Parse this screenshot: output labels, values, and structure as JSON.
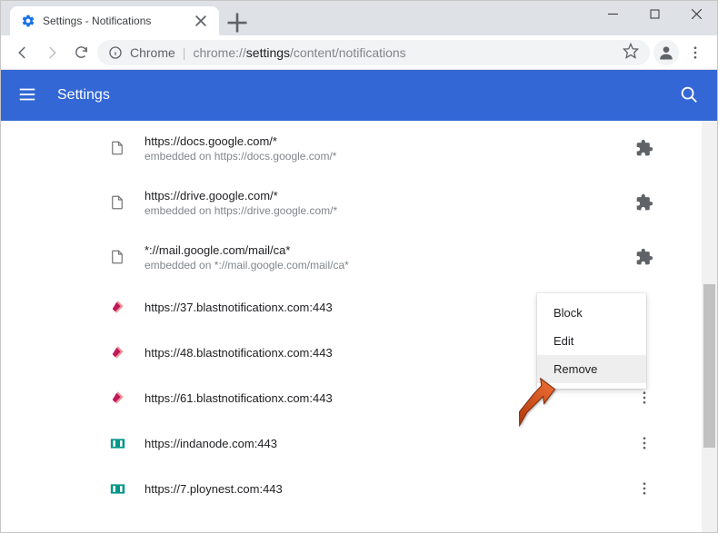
{
  "window": {
    "tab_title": "Settings - Notifications"
  },
  "toolbar": {
    "host_label": "Chrome",
    "url_prefix": "chrome://",
    "url_segment1": "settings",
    "url_segment2": "/content/notifications"
  },
  "header": {
    "title": "Settings"
  },
  "sites": [
    {
      "url": "https://docs.google.com/*",
      "sub": "embedded on https://docs.google.com/*",
      "icon": "file",
      "action": "puzzle"
    },
    {
      "url": "https://drive.google.com/*",
      "sub": "embedded on https://drive.google.com/*",
      "icon": "file",
      "action": "puzzle"
    },
    {
      "url": "*://mail.google.com/mail/ca*",
      "sub": "embedded on *://mail.google.com/mail/ca*",
      "icon": "file",
      "action": "puzzle"
    },
    {
      "url": "https://37.blastnotificationx.com:443",
      "sub": "",
      "icon": "bell",
      "action": "dots"
    },
    {
      "url": "https://48.blastnotificationx.com:443",
      "sub": "",
      "icon": "bell",
      "action": "dots"
    },
    {
      "url": "https://61.blastnotificationx.com:443",
      "sub": "",
      "icon": "bell",
      "action": "dots"
    },
    {
      "url": "https://indanode.com:443",
      "sub": "",
      "icon": "teal",
      "action": "dots"
    },
    {
      "url": "https://7.ploynest.com:443",
      "sub": "",
      "icon": "teal",
      "action": "dots"
    }
  ],
  "menu": {
    "block": "Block",
    "edit": "Edit",
    "remove": "Remove"
  }
}
